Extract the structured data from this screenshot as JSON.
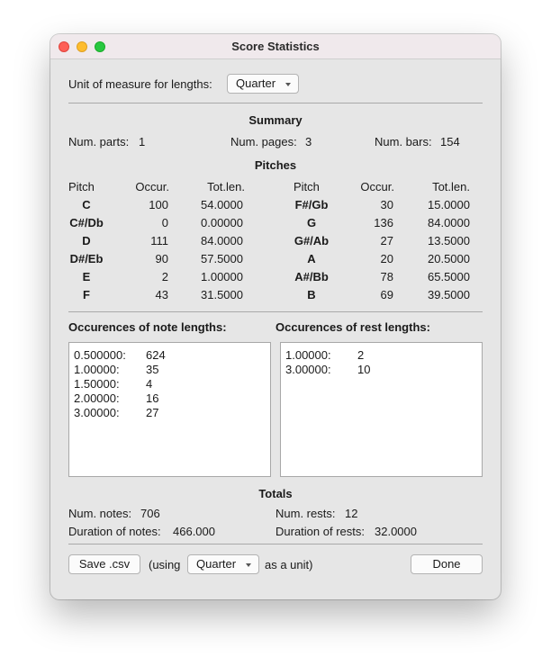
{
  "window": {
    "title": "Score Statistics"
  },
  "unit": {
    "label": "Unit of measure for lengths:",
    "value": "Quarter"
  },
  "summary": {
    "title": "Summary",
    "parts_label": "Num. parts:",
    "parts": "1",
    "pages_label": "Num. pages:",
    "pages": "3",
    "bars_label": "Num. bars:",
    "bars": "154"
  },
  "pitches": {
    "title": "Pitches",
    "headers": {
      "pitch": "Pitch",
      "occur": "Occur.",
      "totlen": "Tot.len."
    },
    "left": [
      {
        "pitch": "C",
        "occur": "100",
        "totlen": "54.0000"
      },
      {
        "pitch": "C#/Db",
        "occur": "0",
        "totlen": "0.00000"
      },
      {
        "pitch": "D",
        "occur": "111",
        "totlen": "84.0000"
      },
      {
        "pitch": "D#/Eb",
        "occur": "90",
        "totlen": "57.5000"
      },
      {
        "pitch": "E",
        "occur": "2",
        "totlen": "1.00000"
      },
      {
        "pitch": "F",
        "occur": "43",
        "totlen": "31.5000"
      }
    ],
    "right": [
      {
        "pitch": "F#/Gb",
        "occur": "30",
        "totlen": "15.0000"
      },
      {
        "pitch": "G",
        "occur": "136",
        "totlen": "84.0000"
      },
      {
        "pitch": "G#/Ab",
        "occur": "27",
        "totlen": "13.5000"
      },
      {
        "pitch": "A",
        "occur": "20",
        "totlen": "20.5000"
      },
      {
        "pitch": "A#/Bb",
        "occur": "78",
        "totlen": "65.5000"
      },
      {
        "pitch": "B",
        "occur": "69",
        "totlen": "39.5000"
      }
    ]
  },
  "note_lengths": {
    "title": "Occurences of note lengths:",
    "items": [
      {
        "length": "0.500000:",
        "count": "624"
      },
      {
        "length": "1.00000:",
        "count": "35"
      },
      {
        "length": "1.50000:",
        "count": "4"
      },
      {
        "length": "2.00000:",
        "count": "16"
      },
      {
        "length": "3.00000:",
        "count": "27"
      }
    ]
  },
  "rest_lengths": {
    "title": "Occurences of rest lengths:",
    "items": [
      {
        "length": "1.00000:",
        "count": "2"
      },
      {
        "length": "3.00000:",
        "count": "10"
      }
    ]
  },
  "totals": {
    "title": "Totals",
    "notes_label": "Num. notes:",
    "notes": "706",
    "rests_label": "Num. rests:",
    "rests": "12",
    "dur_notes_label": "Duration of notes:",
    "dur_notes": "466.000",
    "dur_rests_label": "Duration of rests:",
    "dur_rests": "32.0000"
  },
  "footer": {
    "save_label": "Save .csv",
    "using_label": "(using",
    "unit_value": "Quarter",
    "as_unit_label": "as a unit)",
    "done_label": "Done"
  }
}
